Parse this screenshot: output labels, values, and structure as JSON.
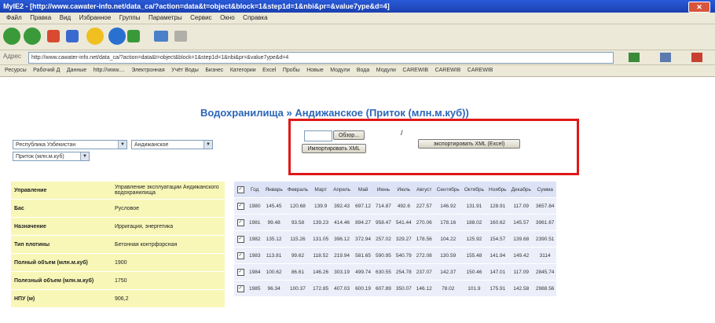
{
  "window": {
    "title": "MyIE2 - [http://www.cawater-info.net/data_ca/?action=data&t=object&block=1&step1d=1&nbi&pr=&value7ype&d=4]"
  },
  "menu": [
    "Файл",
    "Правка",
    "Вид",
    "Избранное",
    "Группы",
    "Параметры",
    "Сервис",
    "Окно",
    "Справка"
  ],
  "address": {
    "label": "Адрес",
    "url": "http://www.cawater-info.net/data_ca/?action=data&t=object&block=1&step1d=1&nbi&pr=&value7ype&d=4"
  },
  "links": [
    "Ресурсы",
    "Рабочий Д",
    "Данные",
    "http://www....",
    "Электронная",
    "Учёт Воды",
    "Бизнес",
    "Категории",
    "Excel",
    "Пробы",
    "Новые",
    "Модули",
    "Вода",
    "Модули",
    "CAREWIB",
    "CAREWIB",
    "CAREWIB"
  ],
  "page": {
    "title": "Водохранилища » Андижанское (Приток (млн.м.куб))"
  },
  "filters": {
    "country": "Республика Узбекистан",
    "reservoir": "Андижанское",
    "param": "Приток (млн.м.куб)"
  },
  "upload": {
    "browse_label": "Обзор...",
    "import_label": "Импортировать XML",
    "slash": "/",
    "export_label": "экспортировать XML (Excel)"
  },
  "info": [
    {
      "key": "Управление",
      "value": "Управление эксплуатации Андижанского водохранилища"
    },
    {
      "key": "Бас",
      "value": "Русловое"
    },
    {
      "key": "Назначение",
      "value": "Ирригация, энергетика"
    },
    {
      "key": "Тип плотины",
      "value": "Бетонная контрфорсная"
    },
    {
      "key": "Полный объем (млн.м.куб)",
      "value": "1900"
    },
    {
      "key": "Полезный объем (млн.м.куб)",
      "value": "1750"
    },
    {
      "key": "НПУ (м)",
      "value": "906,2"
    }
  ],
  "table": {
    "headers": [
      "Год",
      "Январь",
      "Февраль",
      "Март",
      "Апрель",
      "Май",
      "Июнь",
      "Июль",
      "Август",
      "Сентябрь",
      "Октябрь",
      "Ноябрь",
      "Декабрь",
      "Сумма"
    ],
    "rows": [
      [
        "1980",
        "145.45",
        "120.68",
        "139.9",
        "392.43",
        "697.12",
        "714.87",
        "492.6",
        "227.57",
        "146.92",
        "131.91",
        "128.91",
        "117.09",
        "3657.84"
      ],
      [
        "1981",
        "99.48",
        "93.58",
        "139.23",
        "414.46",
        "894.27",
        "958.47",
        "541.44",
        "270.06",
        "178.16",
        "188.02",
        "160.62",
        "145.57",
        "3961.67"
      ],
      [
        "1982",
        "135.12",
        "115.26",
        "131.05",
        "396.12",
        "372.94",
        "257.02",
        "329.27",
        "178.56",
        "104.22",
        "125.92",
        "154.57",
        "139.68",
        "2390.51"
      ],
      [
        "1983",
        "113.81",
        "99.62",
        "118.52",
        "219.94",
        "581.65",
        "590.95",
        "540.79",
        "272.08",
        "130.59",
        "155.48",
        "141.94",
        "149.42",
        "3114"
      ],
      [
        "1984",
        "100.62",
        "86.61",
        "146.26",
        "303.19",
        "499.74",
        "630.55",
        "254.78",
        "237.07",
        "142.37",
        "150.46",
        "147.01",
        "117.09",
        "2845.74"
      ],
      [
        "1985",
        "96.34",
        "100.37",
        "172.85",
        "407.03",
        "600.19",
        "607.89",
        "350.07",
        "146.12",
        "78.02",
        "101.9",
        "175.91",
        "142.58",
        "2988.56"
      ]
    ]
  }
}
